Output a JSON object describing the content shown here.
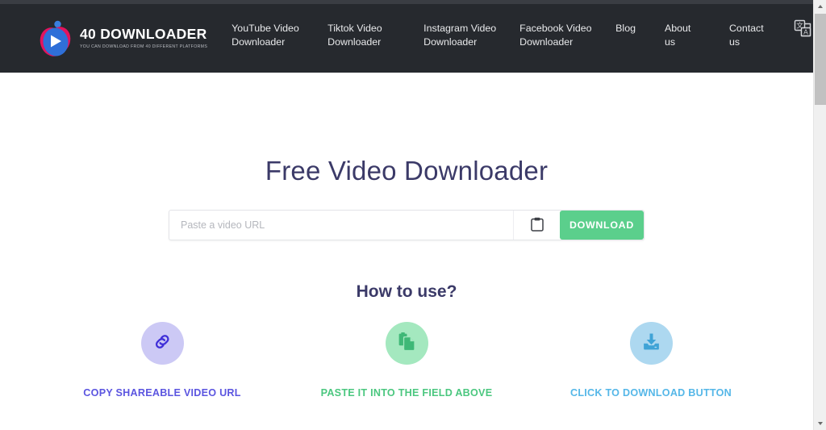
{
  "header": {
    "logo": {
      "title": "40 DOWNLOADER",
      "tagline": "YOU CAN DOWNLOAD FROM 40 DIFFERENT PLATFORMS",
      "icon": "play-circle-logo-icon"
    },
    "nav": [
      {
        "line1": "YouTube Video",
        "line2": "Downloader"
      },
      {
        "line1": "Tiktok Video",
        "line2": "Downloader"
      },
      {
        "line1": "Instagram Video",
        "line2": "Downloader"
      },
      {
        "line1": "Facebook Video",
        "line2": "Downloader"
      },
      {
        "line1": "Blog",
        "line2": ""
      },
      {
        "line1": "About",
        "line2": "us"
      },
      {
        "line1": "Contact",
        "line2": "us"
      }
    ],
    "language": {
      "icon": "translate-icon",
      "caret": "chevron-down-icon"
    },
    "background_color": "#26292e"
  },
  "hero": {
    "title": "Free Video Downloader",
    "title_color": "#3b3a68",
    "input": {
      "placeholder": "Paste a video URL",
      "value": ""
    },
    "paste_button": {
      "icon": "clipboard-icon",
      "label": ""
    },
    "download_button": {
      "label": "DOWNLOAD",
      "color": "#5bcf8c"
    }
  },
  "howto": {
    "title": "How to use?",
    "steps": [
      {
        "label": "COPY SHAREABLE VIDEO URL",
        "icon": "link-icon",
        "circle_color": "#ccc9f5",
        "text_color": "#5b55e0"
      },
      {
        "label": "PASTE IT INTO THE FIELD ABOVE",
        "icon": "paste-documents-icon",
        "circle_color": "#a4e8bf",
        "text_color": "#4bc77f"
      },
      {
        "label": "CLICK TO DOWNLOAD BUTTON",
        "icon": "download-tray-icon",
        "circle_color": "#add8f0",
        "text_color": "#55b7e8"
      }
    ]
  },
  "scrollbar": {
    "up_arrow": "scroll-up-icon",
    "down_arrow": "scroll-down-icon"
  }
}
